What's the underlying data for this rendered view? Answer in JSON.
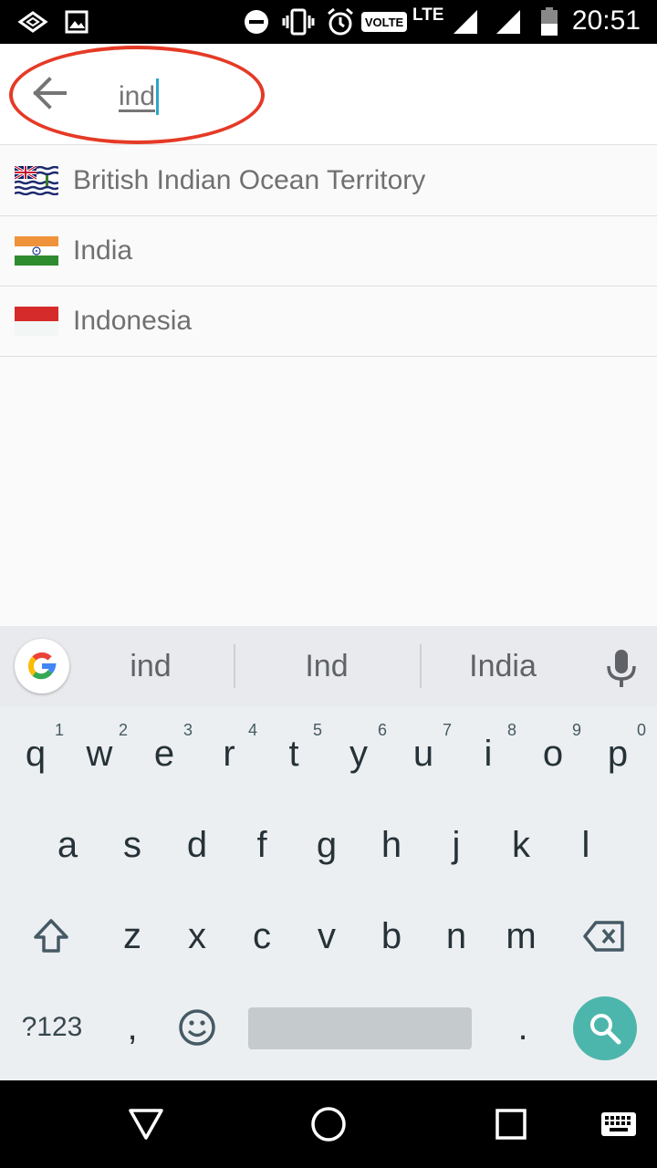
{
  "status_bar": {
    "time": "20:51",
    "volte": "VOLTE",
    "network": "LTE",
    "icons": [
      "cast-icon",
      "image-icon",
      "do-not-disturb-icon",
      "vibrate-icon",
      "alarm-icon",
      "signal-icon",
      "signal-icon",
      "battery-icon"
    ]
  },
  "search": {
    "back_icon": "arrow-back-icon",
    "query": "ind"
  },
  "results": [
    {
      "name": "British Indian Ocean Territory",
      "flag": "british-indian-ocean-territory-flag"
    },
    {
      "name": "India",
      "flag": "india-flag"
    },
    {
      "name": "Indonesia",
      "flag": "indonesia-flag"
    }
  ],
  "keyboard": {
    "suggestions": [
      "ind",
      "Ind",
      "India"
    ],
    "row1": [
      {
        "k": "q",
        "n": "1"
      },
      {
        "k": "w",
        "n": "2"
      },
      {
        "k": "e",
        "n": "3"
      },
      {
        "k": "r",
        "n": "4"
      },
      {
        "k": "t",
        "n": "5"
      },
      {
        "k": "y",
        "n": "6"
      },
      {
        "k": "u",
        "n": "7"
      },
      {
        "k": "i",
        "n": "8"
      },
      {
        "k": "o",
        "n": "9"
      },
      {
        "k": "p",
        "n": "0"
      }
    ],
    "row2": [
      "a",
      "s",
      "d",
      "f",
      "g",
      "h",
      "j",
      "k",
      "l"
    ],
    "row3": [
      "z",
      "x",
      "c",
      "v",
      "b",
      "n",
      "m"
    ],
    "symbols_label": "?123",
    "comma": ",",
    "period": "."
  },
  "colors": {
    "accent_caret": "#2ca6c9",
    "highlight_ring": "#e53a26",
    "search_key": "#4db6ac"
  }
}
